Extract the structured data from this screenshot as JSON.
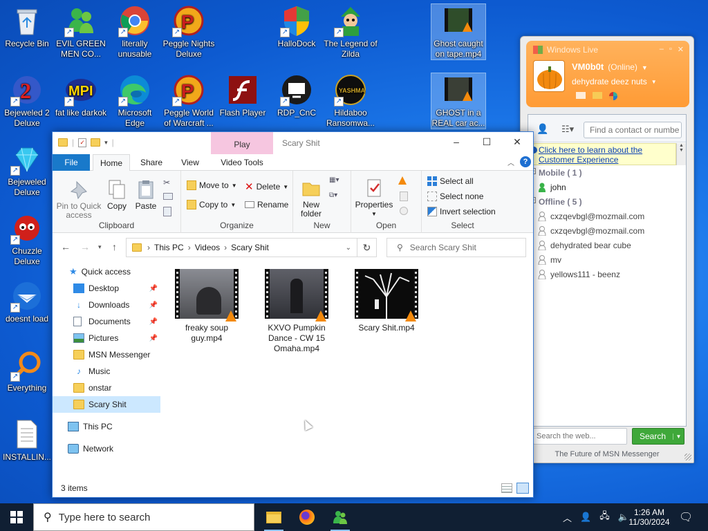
{
  "desktop": {
    "icons": [
      {
        "label": "Recycle Bin",
        "name": "recycle-bin-icon"
      },
      {
        "label": "EVIL GREEN MEN CO...",
        "name": "msn-people-icon"
      },
      {
        "label": "literally unusable",
        "name": "chrome-icon"
      },
      {
        "label": "Peggle Nights Deluxe",
        "name": "peggle-icon"
      },
      {
        "label": "HalloDock",
        "name": "windows-shield-icon"
      },
      {
        "label": "The Legend of Zilda",
        "name": "zelda-icon"
      },
      {
        "label": "Ghost caught on tape.mp4",
        "name": "video-file-icon"
      },
      {
        "label": "Bejeweled 2 Deluxe",
        "name": "bejeweled-icon"
      },
      {
        "label": "fat like darkok",
        "name": "mpi-icon"
      },
      {
        "label": "Microsoft Edge",
        "name": "edge-icon"
      },
      {
        "label": "Peggle World of Warcraft ...",
        "name": "peggle-wow-icon"
      },
      {
        "label": "Flash Player",
        "name": "flash-icon"
      },
      {
        "label": "RDP_CnC",
        "name": "rdp-icon"
      },
      {
        "label": "Hildaboo Ransomwa...",
        "name": "ransomware-icon"
      },
      {
        "label": "GHOST in a REAL car ac...",
        "name": "video-file-icon"
      },
      {
        "label": "Bejeweled Deluxe",
        "name": "diamond-icon"
      },
      {
        "label": "Chuzzle Deluxe",
        "name": "chuzzle-icon"
      },
      {
        "label": "doesnt load",
        "name": "thunderbird-icon"
      },
      {
        "label": "Everything",
        "name": "search-everything-icon"
      },
      {
        "label": "INSTALLIN...",
        "name": "text-file-icon"
      }
    ]
  },
  "explorer": {
    "title": "Scary Shit",
    "contextual_tab": "Play",
    "tabs": [
      "File",
      "Home",
      "Share",
      "View",
      "Video Tools"
    ],
    "ribbon": {
      "clipboard": {
        "pin": "Pin to Quick access",
        "copy": "Copy",
        "paste": "Paste",
        "label": "Clipboard"
      },
      "organize": {
        "move_to": "Move to",
        "copy_to": "Copy to",
        "delete": "Delete",
        "rename": "Rename",
        "label": "Organize"
      },
      "new": {
        "new_folder": "New folder",
        "label": "New"
      },
      "open": {
        "properties": "Properties",
        "label": "Open"
      },
      "select": {
        "select_all": "Select all",
        "select_none": "Select none",
        "invert": "Invert selection",
        "label": "Select"
      }
    },
    "breadcrumb": [
      "This PC",
      "Videos",
      "Scary Shit"
    ],
    "search_placeholder": "Search Scary Shit",
    "nav": [
      {
        "label": "Quick access",
        "name": "nav-quick-access"
      },
      {
        "label": "Desktop",
        "name": "nav-desktop",
        "pinned": true
      },
      {
        "label": "Downloads",
        "name": "nav-downloads",
        "pinned": true
      },
      {
        "label": "Documents",
        "name": "nav-documents",
        "pinned": true
      },
      {
        "label": "Pictures",
        "name": "nav-pictures",
        "pinned": true
      },
      {
        "label": "MSN Messenger",
        "name": "nav-msn-messenger"
      },
      {
        "label": "Music",
        "name": "nav-music"
      },
      {
        "label": "onstar",
        "name": "nav-onstar"
      },
      {
        "label": "Scary Shit",
        "name": "nav-scary-shit"
      },
      {
        "label": "This PC",
        "name": "nav-this-pc"
      },
      {
        "label": "Network",
        "name": "nav-network"
      }
    ],
    "files": [
      {
        "name": "freaky soup guy.mp4"
      },
      {
        "name": "KXVO Pumpkin Dance - CW 15 Omaha.mp4"
      },
      {
        "name": "Scary Shit.mp4"
      }
    ],
    "status": "3 items"
  },
  "messenger": {
    "title": "Windows Live",
    "username": "VM0b0t",
    "status": "(Online)",
    "personal_message": "dehydrate deez nuts",
    "find_placeholder": "Find a contact or numbe",
    "banner": "Click here to learn about the Customer Experience",
    "groups": [
      {
        "label": "Mobile ( 1 )",
        "contacts": [
          "john"
        ]
      },
      {
        "label": "Offline ( 5 )",
        "contacts": [
          "cxzqevbgl@mozmail.com",
          "cxzqevbgl@mozmail.com",
          "dehydrated bear cube",
          "mv",
          "yellows111 - beenz"
        ]
      }
    ],
    "search_placeholder": "Search the web...",
    "search_button": "Search",
    "footer": "The Future of MSN Messenger"
  },
  "taskbar": {
    "search_placeholder": "Type here to search",
    "time": "1:26 AM",
    "date": "11/30/2024"
  },
  "colors": {
    "accent": "#0078d7",
    "msn_orange": "#ff9b35",
    "search_green": "#3fa83a"
  }
}
